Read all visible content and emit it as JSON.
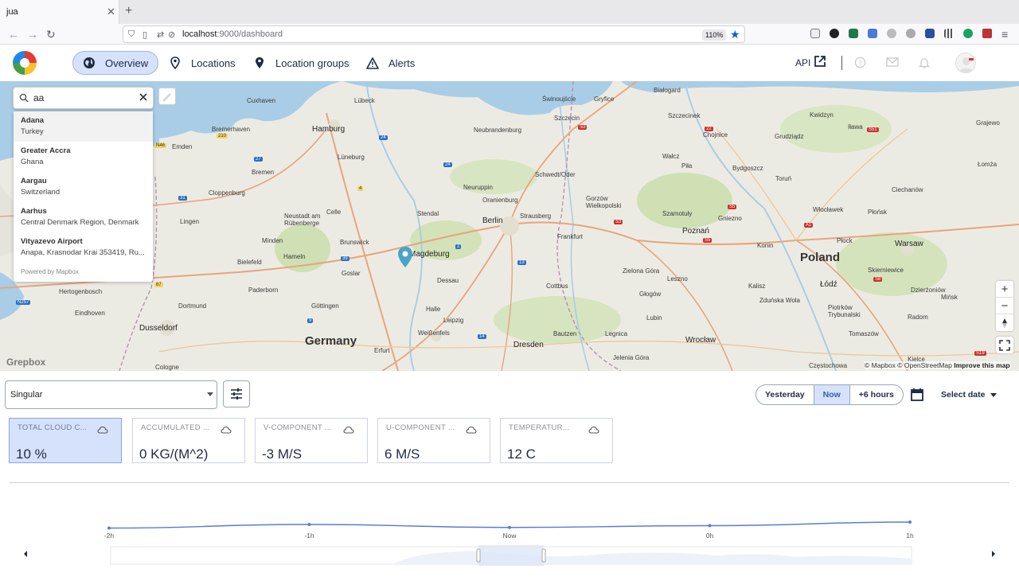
{
  "browser": {
    "tab_title": "jua",
    "url_host": "localhost",
    "url_path": ":9000/dashboard",
    "zoom": "110%"
  },
  "header": {
    "nav": [
      {
        "label": "Overview",
        "icon": "globe-icon",
        "active": true
      },
      {
        "label": "Locations",
        "icon": "map-pin-icon"
      },
      {
        "label": "Location groups",
        "icon": "map-pin-group-icon"
      },
      {
        "label": "Alerts",
        "icon": "warning-triangle-icon"
      }
    ],
    "api_label": "API"
  },
  "map": {
    "search": {
      "value": "aa"
    },
    "suggestions": [
      {
        "name": "Adana",
        "detail": "Turkey"
      },
      {
        "name": "Greater Accra",
        "detail": "Ghana"
      },
      {
        "name": "Aargau",
        "detail": "Switzerland"
      },
      {
        "name": "Aarhus",
        "detail": "Central Denmark Region, Denmark"
      },
      {
        "name": "Vityazevo Airport",
        "detail": "Anapa, Krasnodar Krai 353419, Ru..."
      }
    ],
    "powered_by": "Powered by Mapbox",
    "countries": [
      "Germany",
      "Poland"
    ],
    "cities": [
      "Cuxhaven",
      "Lübeck",
      "Świnoujście",
      "Gryfice",
      "Białogard",
      "Szczecinek",
      "Kwidzyn",
      "Iława",
      "Grajewo",
      "Bremerhaven",
      "Hamburg",
      "Neubrandenburg",
      "Szczecin",
      "Chojnice",
      "Grudziądz",
      "Emden",
      "Bremen",
      "Lüneburg",
      "Schwedt/Oder",
      "Wałcz",
      "Piła",
      "Bydgoszcz",
      "Toruń",
      "Łomża",
      "Cloppenburg",
      "Neuruppin",
      "Oranienburg",
      "Gorzów Wielkopolski",
      "Ciechanów",
      "Lingen",
      "Neustadt am Rübenberge",
      "Celle",
      "Stendal",
      "Berlin",
      "Strausberg",
      "Szamotuły",
      "Gniezno",
      "Włocławek",
      "Płońsk",
      "Minden",
      "Brunswick",
      "Frankfurt",
      "Poznań",
      "Płock",
      "Bielefeld",
      "Hameln",
      "Magdeburg",
      "Konin",
      "Warsaw",
      "Goslar",
      "Dessau",
      "Cottbus",
      "Zielona Góra",
      "Leszno",
      "Kalisz",
      "Skierniewice",
      "Dzierżoniów",
      "Paderborn",
      "Göttingen",
      "Halle",
      "Głogów",
      "Łódź",
      "Mińsk",
      "Hertogenbosch",
      "Eindhoven",
      "Dortmund",
      "Leipzig",
      "Bautzen",
      "Lubin",
      "Zduńska Wola",
      "Piotrków Trybunalski",
      "Radom",
      "Dusseldorf",
      "Weißenfels",
      "Legnica",
      "Wrocław",
      "Tomaszów",
      "Erfurt",
      "Dresden",
      "Jelenia Góra",
      "Częstochowa",
      "Cologne",
      "Kielce"
    ],
    "attribution": "© Mapbox © OpenStreetMap",
    "improve": "Improve this map",
    "logo_text": "Grepbox"
  },
  "controls": {
    "mode_select": "Singular",
    "time_options": [
      {
        "label": "Yesterday"
      },
      {
        "label": "Now",
        "active": true
      },
      {
        "label": "+6 hours"
      }
    ],
    "select_date": "Select date"
  },
  "metrics": [
    {
      "label": "TOTAL CLOUD C...",
      "value": "10 %",
      "active": true
    },
    {
      "label": "ACCUMULATED ...",
      "value": "0 KG/(M^2)"
    },
    {
      "label": "V-COMPONENT ...",
      "value": "-3 M/S"
    },
    {
      "label": "U-COMPONENT ...",
      "value": "6 M/S"
    },
    {
      "label": "TEMPERATUR...",
      "value": "12 C"
    }
  ],
  "chart_data": {
    "type": "line",
    "categories": [
      "-2h",
      "-1h",
      "Now",
      "0h",
      "1h"
    ],
    "series": [
      {
        "values": [
          8.6,
          10.4,
          8.9,
          9.8,
          11.6
        ]
      }
    ],
    "ylim": [
      0,
      20
    ],
    "grid": false
  },
  "colors": {
    "accent": "#5b7bd5",
    "active_bg": "#d6e2fb"
  }
}
